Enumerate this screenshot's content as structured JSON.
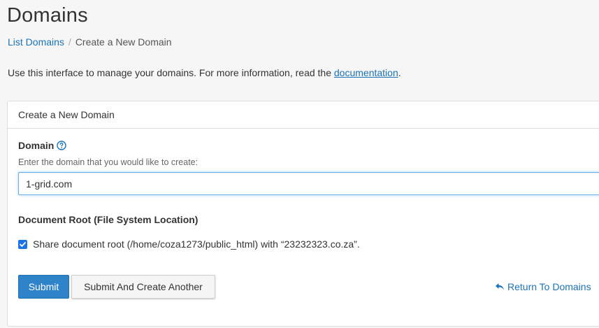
{
  "header": {
    "title": "Domains"
  },
  "breadcrumb": {
    "parent": "List Domains",
    "separator": "/",
    "current": "Create a New Domain"
  },
  "intro": {
    "text": "Use this interface to manage your domains. For more information, read the ",
    "link_text": "documentation",
    "suffix": "."
  },
  "panel": {
    "heading": "Create a New Domain",
    "domain": {
      "label": "Domain",
      "help_text": "Enter the domain that you would like to create:",
      "value": "1-grid.com",
      "help_icon": "question-circle-icon"
    },
    "docroot": {
      "label": "Document Root (File System Location)",
      "share_checked": true,
      "share_label": "Share document root (/home/coza1273/public_html) with “23232323.co.za”."
    },
    "actions": {
      "submit_label": "Submit",
      "submit_another_label": "Submit And Create Another",
      "return_label": "Return To Domains",
      "return_icon": "reply-arrow-icon"
    }
  },
  "colors": {
    "accent": "#1a73b8",
    "primary_button": "#2f83c9",
    "focus_border": "#66afe9"
  }
}
